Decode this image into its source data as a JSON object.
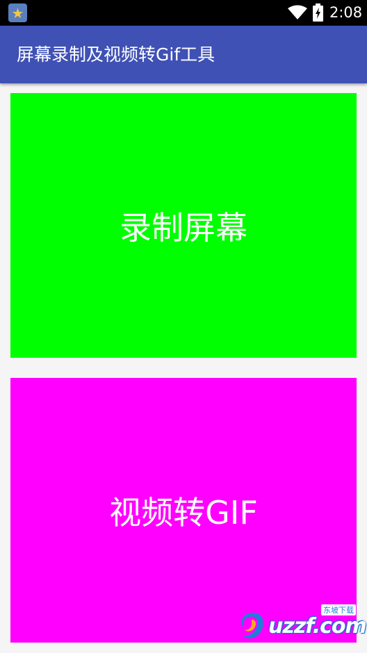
{
  "status_bar": {
    "time": "2:08",
    "icons": [
      "app-star-icon",
      "wifi-icon",
      "battery-charging-icon"
    ]
  },
  "app_bar": {
    "title": "屏幕录制及视频转Gif工具",
    "color": "#3f51b5"
  },
  "tiles": [
    {
      "label": "录制屏幕",
      "color": "#00ff00"
    },
    {
      "label": "视频转GIF",
      "color": "#ff00ff"
    }
  ],
  "watermark": {
    "text": "uzzf.com",
    "subtext": "东坡下载"
  }
}
